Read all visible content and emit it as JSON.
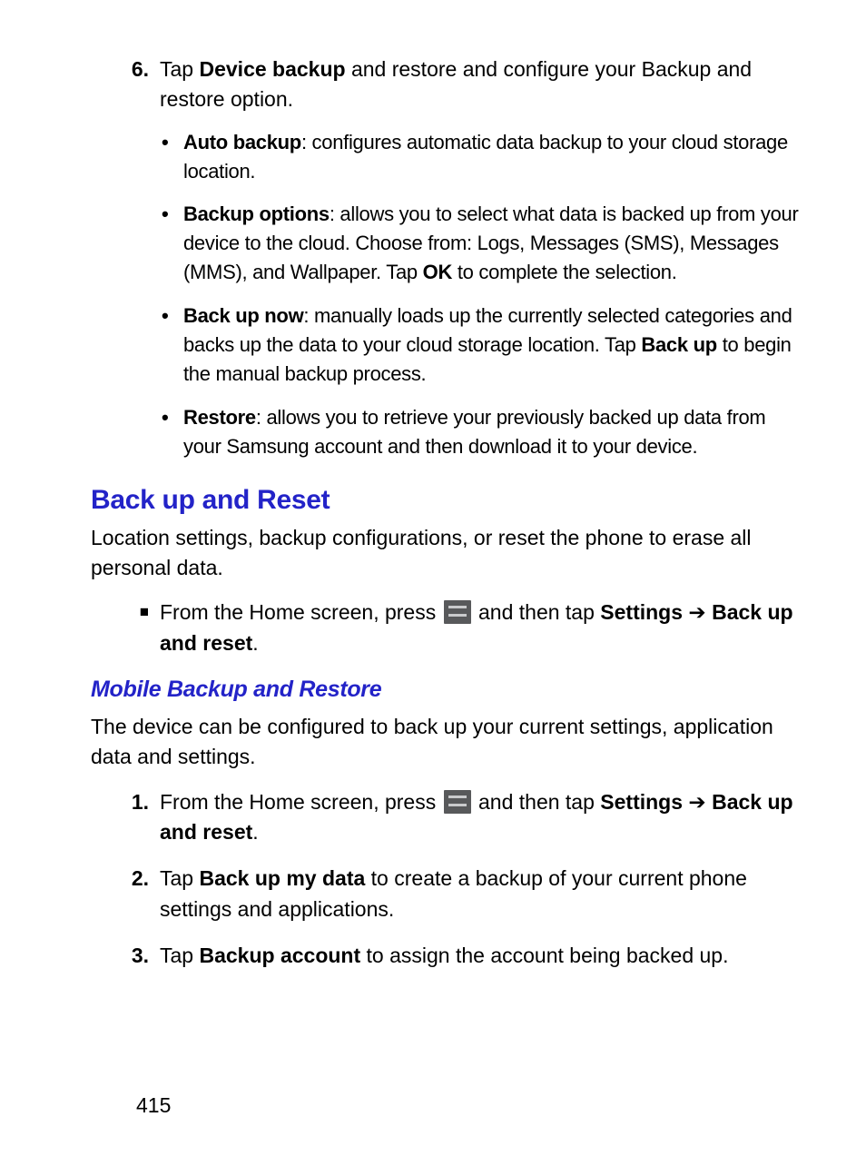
{
  "step6": {
    "num": "6.",
    "text_before": "Tap ",
    "bold1": "Device backup",
    "text_after": " and restore and configure your Backup and restore option."
  },
  "sub": [
    {
      "bold": "Auto backup",
      "rest": ": configures automatic data backup to your cloud storage location."
    },
    {
      "bold": "Backup options",
      "rest_before": ": allows you to select what data is backed up from your device to the cloud. Choose from: Logs, Messages (SMS), Messages (MMS), and Wallpaper. Tap ",
      "bold2": "OK",
      "rest_after": " to complete the selection."
    },
    {
      "bold": "Back up now",
      "rest_before": ": manually loads up the currently selected categories and backs up the data to your cloud storage location. Tap ",
      "bold2": "Back up",
      "rest_after": " to begin the manual backup process."
    },
    {
      "bold": "Restore",
      "rest": ": allows you to retrieve your previously backed up data from your Samsung account and then download it to your device."
    }
  ],
  "heading": "Back up and Reset",
  "section_intro": "Location settings, backup configurations, or reset the phone to erase all personal data.",
  "square_step": {
    "before": "From the Home screen, press ",
    "after1": " and then tap ",
    "bold1": "Settings",
    "arrow": " ➔ ",
    "bold2": "Back up and reset",
    "period": "."
  },
  "subheading": "Mobile Backup and Restore",
  "sub_intro": "The device can be configured to back up your current settings, application data and settings.",
  "steps": [
    {
      "num": "1.",
      "before": "From the Home screen, press ",
      "after1": " and then tap ",
      "bold1": "Settings",
      "arrow": " ➔ ",
      "bold2": "Back up and reset",
      "period": "."
    },
    {
      "num": "2.",
      "before": "Tap ",
      "bold1": "Back up my data",
      "after": " to create a backup of your current phone settings and applications."
    },
    {
      "num": "3.",
      "before": "Tap ",
      "bold1": "Backup account",
      "after": " to assign the account being backed up."
    }
  ],
  "page_number": "415"
}
